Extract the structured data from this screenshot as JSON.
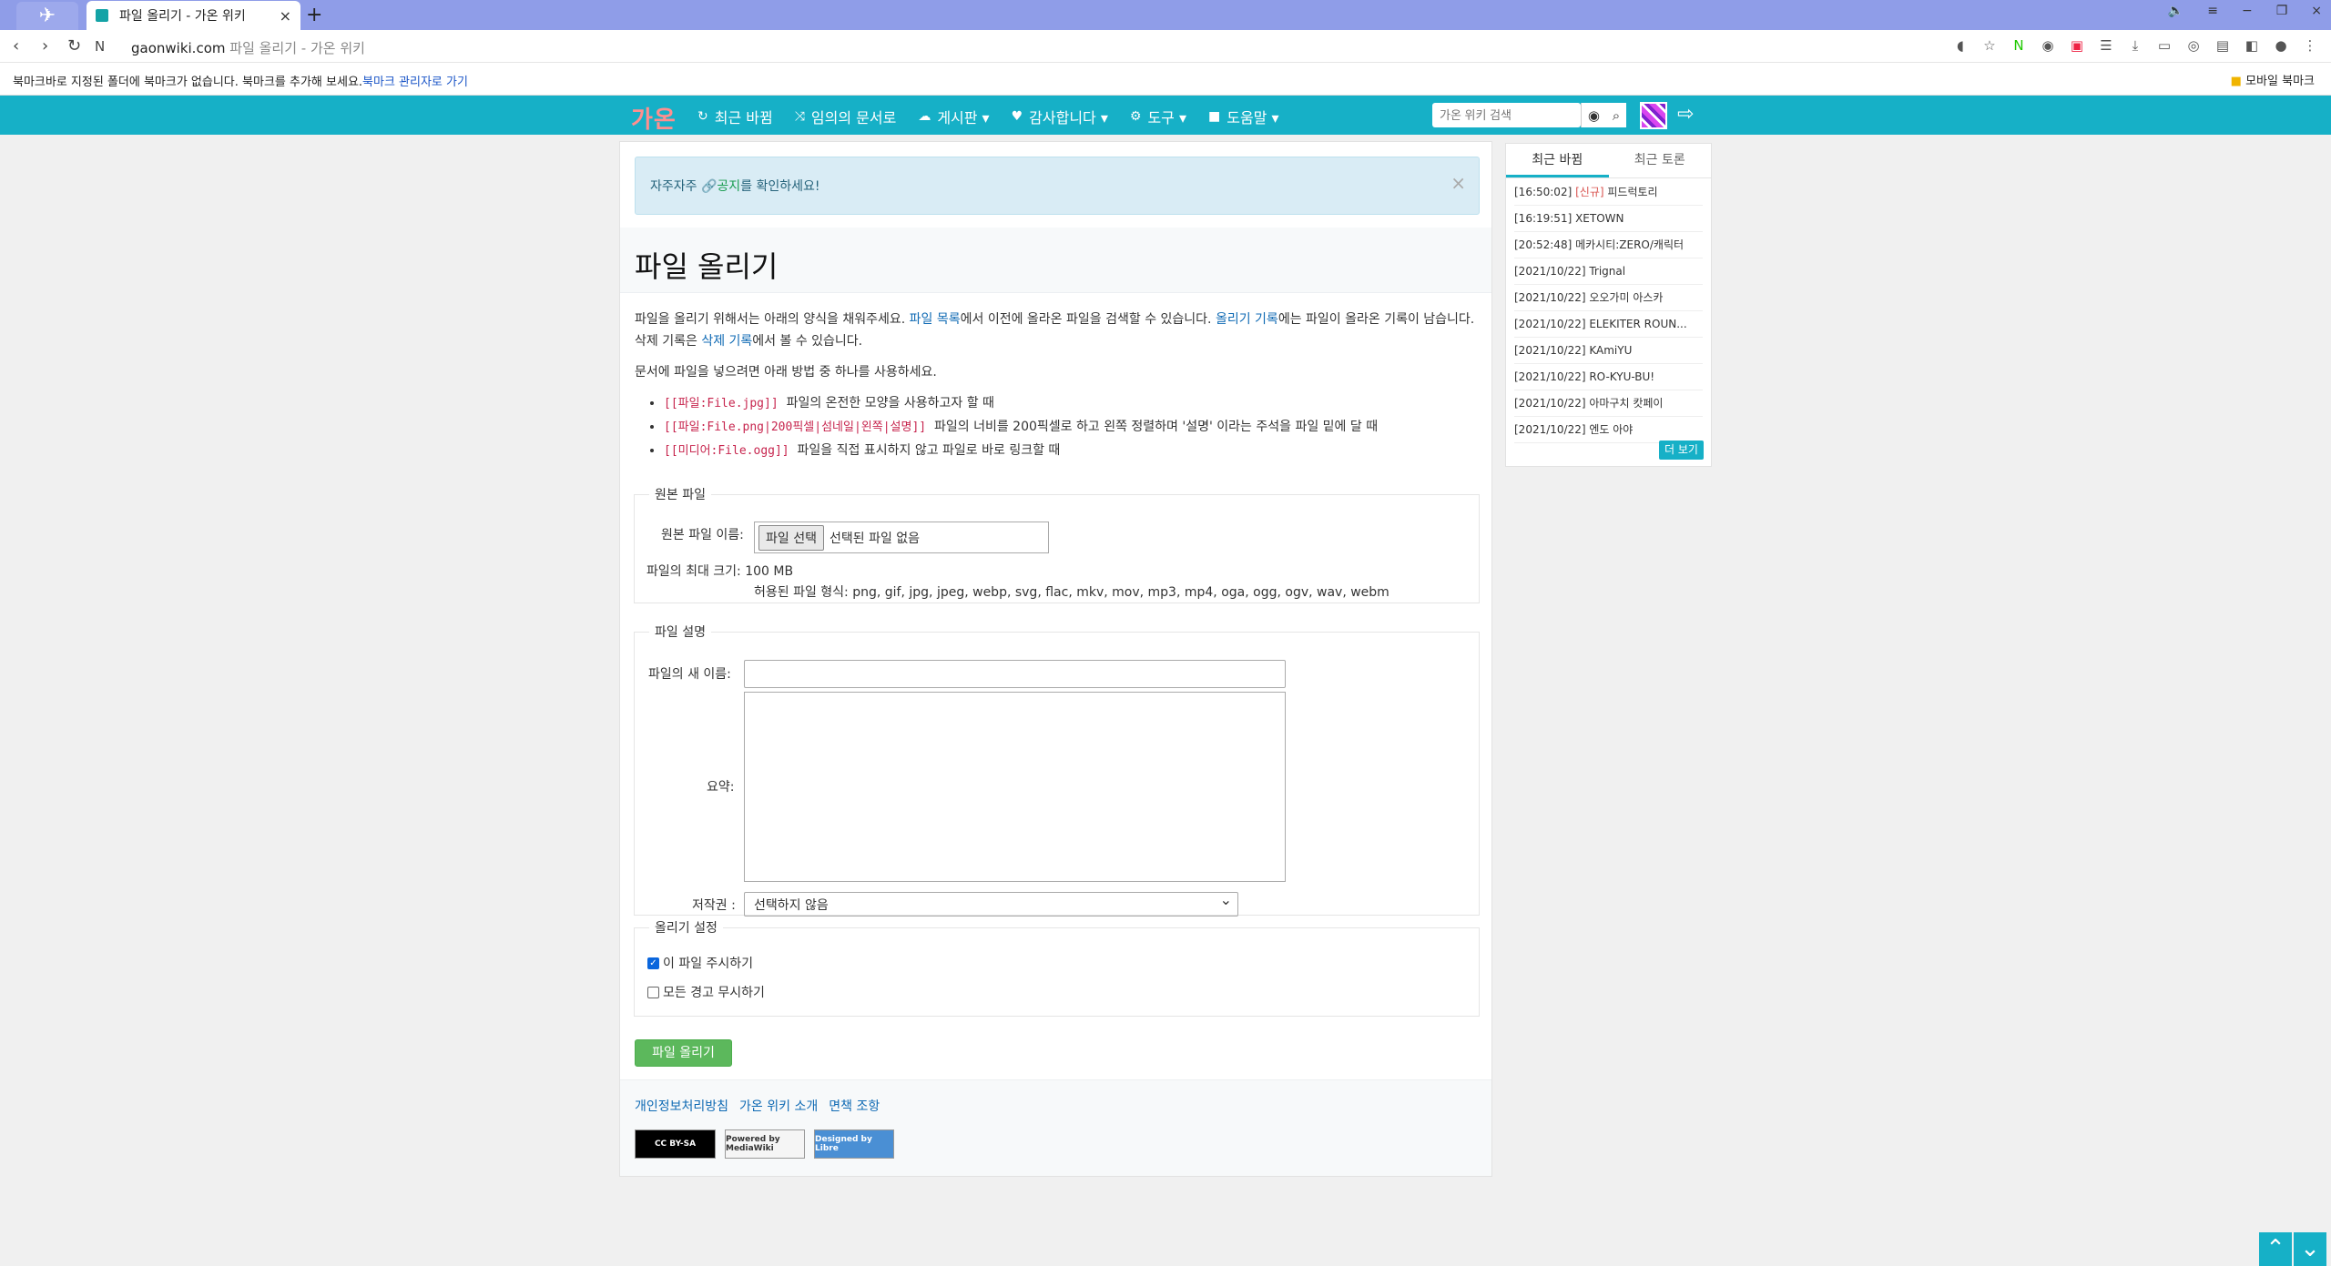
{
  "browser": {
    "tab_title": "파일 올리기 - 가온 위키",
    "new_tab": "+",
    "address_domain": "gaonwiki.com",
    "address_rest": " 파일 올리기 - 가온 위키",
    "bookmark_message": "북마크바로 지정된 폴더에 북마크가 없습니다. 북마크를 추가해 보세요.",
    "bookmark_link": "북마크 관리자로 가기",
    "mobile_bookmarks": "모바일 북마크"
  },
  "navbar": {
    "brand": "가온",
    "items": [
      {
        "icon": "↻",
        "label": "최근 바뀜"
      },
      {
        "icon": "⤨",
        "label": "임의의 문서로"
      },
      {
        "icon": "☁",
        "label": "게시판 ▾"
      },
      {
        "icon": "♥",
        "label": "감사합니다 ▾"
      },
      {
        "icon": "⚙",
        "label": "도구 ▾"
      },
      {
        "icon": "■",
        "label": "도움말 ▾"
      }
    ],
    "search_placeholder": "가온 위키 검색",
    "logout_icon": "⇨"
  },
  "notice": {
    "prefix": "자주자주 ",
    "link": "공지",
    "suffix": "를 확인하세요!",
    "close": "×"
  },
  "page": {
    "title": "파일 올리기",
    "intro_1": "파일을 올리기 위해서는 아래의 양식을 채워주세요. ",
    "link_file_list": "파일 목록",
    "intro_2": "에서 이전에 올라온 파일을 검색할 수 있습니다. ",
    "link_upload_log": "올리기 기록",
    "intro_3": "에는 파일이 올라온 기록이 남습니다. 삭제 기록은 ",
    "link_delete_log": "삭제 기록",
    "intro_4": "에서 볼 수 있습니다.",
    "usage_intro": "문서에 파일을 넣으려면 아래 방법 중 하나를 사용하세요.",
    "usage": [
      {
        "code": "[[파일:File.jpg]]",
        "desc": "파일의 온전한 모양을 사용하고자 할 때"
      },
      {
        "code": "[[파일:File.png|200픽셀|섬네일|왼쪽|설명]]",
        "desc": "파일의 너비를 200픽셀로 하고 왼쪽 정렬하며 '설명' 이라는 주석을 파일 밑에 달 때"
      },
      {
        "code": "[[미디어:File.ogg]]",
        "desc": "파일을 직접 표시하지 않고 파일로 바로 링크할 때"
      }
    ]
  },
  "source_file": {
    "legend": "원본 파일",
    "name_label": "원본 파일 이름:",
    "choose_button": "파일 선택",
    "no_file": "선택된 파일 없음",
    "max_size": "파일의 최대 크기: 100 MB",
    "allowed": "허용된 파일 형식: png, gif, jpg, jpeg, webp, svg, flac, mkv, mov, mp3, mp4, oga, ogg, ogv, wav, webm"
  },
  "description": {
    "legend": "파일 설명",
    "new_name_label": "파일의 새 이름:",
    "summary_label": "요약:",
    "license_label": "저작권 :",
    "license_value": "선택하지 않음"
  },
  "options": {
    "legend": "올리기 설정",
    "watch": "이 파일 주시하기",
    "ignore": "모든 경고 무시하기"
  },
  "upload_button": "파일 올리기",
  "footer": {
    "links": [
      "개인정보처리방침",
      "가온 위키 소개",
      "면책 조항"
    ],
    "badges": [
      "CC BY-SA",
      "Powered by MediaWiki",
      "Designed by Libre"
    ]
  },
  "sidebar": {
    "tabs": [
      "최근 바뀜",
      "최근 토론"
    ],
    "items": [
      {
        "time": "[16:50:02]",
        "new": "[신규]",
        "title": " 피드럭토리"
      },
      {
        "time": "[16:19:51]",
        "new": "",
        "title": " XETOWN"
      },
      {
        "time": "[20:52:48]",
        "new": "",
        "title": " 메카시티:ZERO/캐릭터"
      },
      {
        "time": "[2021/10/22]",
        "new": "",
        "title": " Trignal"
      },
      {
        "time": "[2021/10/22]",
        "new": "",
        "title": " 오오가미 아스카"
      },
      {
        "time": "[2021/10/22]",
        "new": "",
        "title": " ELEKITER ROUN..."
      },
      {
        "time": "[2021/10/22]",
        "new": "",
        "title": " KAmiYU"
      },
      {
        "time": "[2021/10/22]",
        "new": "",
        "title": " RO-KYU-BU!"
      },
      {
        "time": "[2021/10/22]",
        "new": "",
        "title": " 아마구치 캇페이"
      },
      {
        "time": "[2021/10/22]",
        "new": "",
        "title": " 엔도 아야"
      }
    ],
    "more": "더 보기"
  },
  "scroll": {
    "up": "⌃",
    "down": "⌄"
  }
}
